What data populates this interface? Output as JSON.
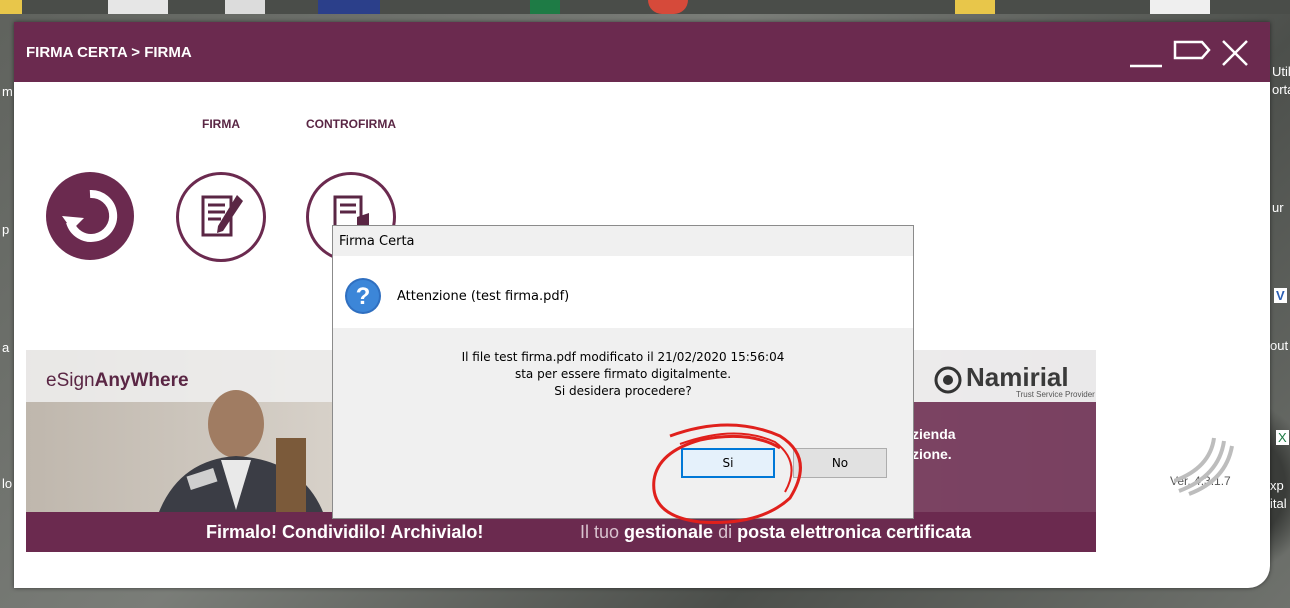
{
  "window": {
    "title": "FIRMA CERTA > FIRMA",
    "version": "Ver. 4.3.1.7"
  },
  "tabs": [
    {
      "label": "FIRMA"
    },
    {
      "label": "CONTROFIRMA"
    }
  ],
  "banner": {
    "brand_prefix": "eSign",
    "brand_suffix": "AnyWhere",
    "partner": "Namirial",
    "partner_sub": "Trust Service Provider",
    "partial_line1": "zienda",
    "partial_line2": "zione.",
    "slogan_left": "Firmalo! Condividilo! Archivialo!",
    "slogan_right_1": "Il tuo ",
    "slogan_right_2": "gestionale",
    "slogan_right_3": " di ",
    "slogan_right_4": "posta elettronica certificata"
  },
  "dialog": {
    "title": "Firma Certa",
    "heading": "Attenzione (test firma.pdf)",
    "message_line1": "Il file test firma.pdf modificato il 21/02/2020 15:56:04",
    "message_line2": "sta per essere firmato digitalmente.",
    "message_line3": "Si desidera procedere?",
    "yes_label": "Si",
    "no_label": "No"
  },
  "desktop": {
    "side_texts": [
      "m",
      "p",
      "a",
      "lo",
      "Util",
      "orta",
      "ur",
      "V",
      "out",
      "X",
      "xp",
      "ital"
    ]
  },
  "colors": {
    "brand": "#6b2a4f",
    "dialog_bg": "#f0f0f0",
    "focus": "#0078d7",
    "annotation": "#e0201c"
  }
}
